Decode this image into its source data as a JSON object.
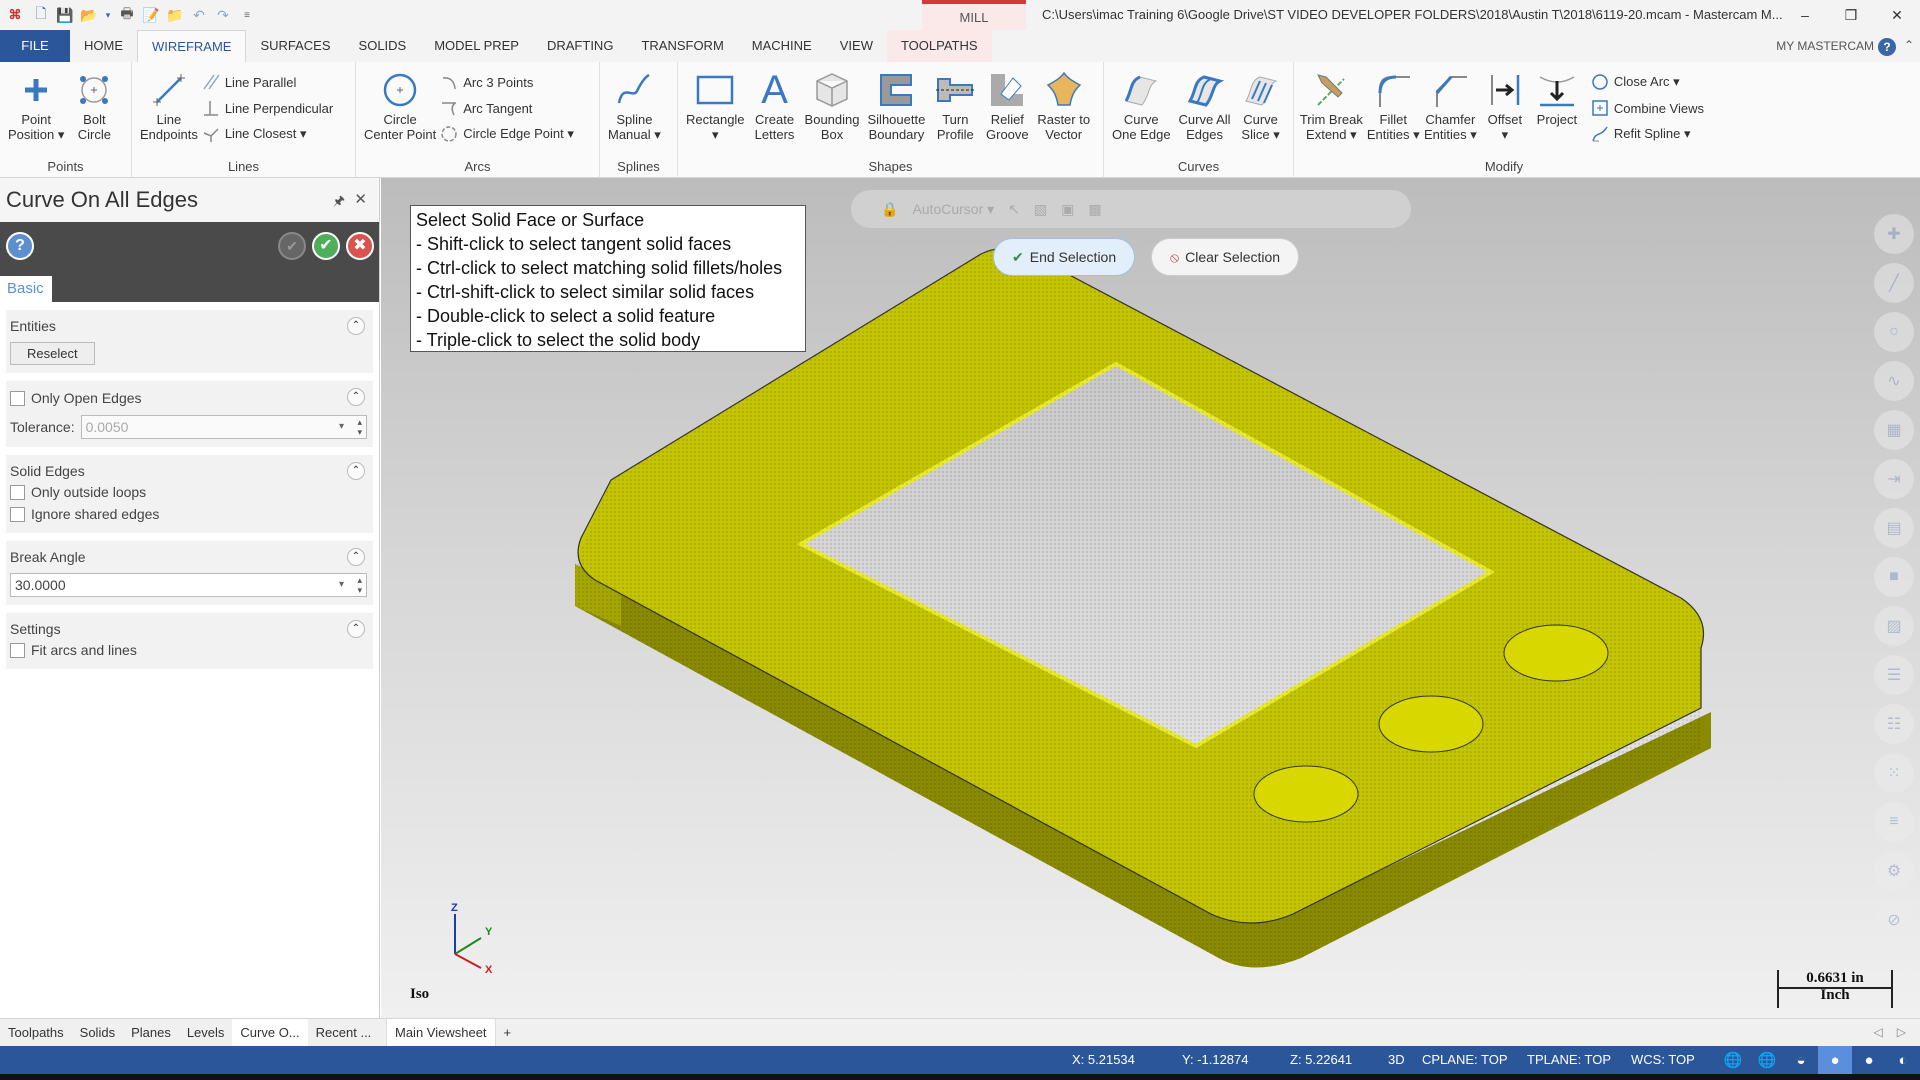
{
  "titlebar": {
    "app_logo": "mastercam-logo",
    "quick_access": [
      "new-file-icon",
      "save-icon",
      "open-icon",
      "dropdown-icon",
      "print-icon",
      "save-as-icon",
      "folder-icon",
      "undo-icon",
      "redo-icon",
      "customize-icon"
    ],
    "context_tab": "MILL",
    "title": "C:\\Users\\imac Training 6\\Google Drive\\ST VIDEO DEVELOPER FOLDERS\\2018\\Austin T\\2018\\6119-20.mcam - Mastercam M...",
    "window_buttons": {
      "minimize": "–",
      "restore": "❒",
      "close": "✕"
    }
  },
  "tabs": [
    "FILE",
    "HOME",
    "WIREFRAME",
    "SURFACES",
    "SOLIDS",
    "MODEL PREP",
    "DRAFTING",
    "TRANSFORM",
    "MACHINE",
    "VIEW",
    "TOOLPATHS"
  ],
  "active_tab": "WIREFRAME",
  "my_mastercam": "MY MASTERCAM",
  "help_label": "?",
  "ribbon": {
    "points": {
      "label": "Points",
      "buttons": [
        {
          "l1": "Point",
          "l2": "Position ▾"
        },
        {
          "l1": "Bolt",
          "l2": "Circle"
        }
      ]
    },
    "lines": {
      "label": "Lines",
      "big": {
        "l1": "Line",
        "l2": "Endpoints"
      },
      "small": [
        "Line Parallel",
        "Line Perpendicular",
        "Line Closest ▾"
      ]
    },
    "arcs": {
      "label": "Arcs",
      "big": {
        "l1": "Circle",
        "l2": "Center Point"
      },
      "small": [
        "Arc 3 Points",
        "Arc Tangent",
        "Circle Edge Point ▾"
      ]
    },
    "splines": {
      "label": "Splines",
      "big": {
        "l1": "Spline",
        "l2": "Manual ▾"
      }
    },
    "shapes": {
      "label": "Shapes",
      "buttons": [
        {
          "l1": "Rectangle",
          "l2": "▾"
        },
        {
          "l1": "Create",
          "l2": "Letters"
        },
        {
          "l1": "Bounding",
          "l2": "Box"
        },
        {
          "l1": "Silhouette",
          "l2": "Boundary"
        },
        {
          "l1": "Turn",
          "l2": "Profile"
        },
        {
          "l1": "Relief",
          "l2": "Groove"
        },
        {
          "l1": "Raster to",
          "l2": "Vector"
        }
      ]
    },
    "curves": {
      "label": "Curves",
      "buttons": [
        {
          "l1": "Curve",
          "l2": "One Edge"
        },
        {
          "l1": "Curve All",
          "l2": "Edges"
        },
        {
          "l1": "Curve",
          "l2": "Slice ▾"
        }
      ]
    },
    "modify": {
      "label": "Modify",
      "buttons": [
        {
          "l1": "Trim Break",
          "l2": "Extend ▾"
        },
        {
          "l1": "Fillet",
          "l2": "Entities ▾"
        },
        {
          "l1": "Chamfer",
          "l2": "Entities ▾"
        },
        {
          "l1": "Offset",
          "l2": "▾"
        },
        {
          "l1": "Project",
          "l2": ""
        }
      ],
      "small": [
        "Close Arc ▾",
        "Combine Views",
        "Refit Spline ▾"
      ]
    }
  },
  "panel": {
    "title": "Curve On All Edges",
    "tab": "Basic",
    "entities": {
      "header": "Entities",
      "button": "Reselect"
    },
    "open_edges": {
      "checkbox": "Only Open Edges",
      "checked": false,
      "tolerance_label": "Tolerance:",
      "tolerance_value": "0.0050"
    },
    "solid_edges": {
      "header": "Solid Edges",
      "opt1": "Only outside loops",
      "opt2": "Ignore shared edges"
    },
    "break_angle": {
      "header": "Break Angle",
      "value": "30.0000"
    },
    "settings": {
      "header": "Settings",
      "opt1": "Fit arcs and lines"
    }
  },
  "viewport": {
    "prompt": [
      "Select Solid Face or Surface",
      "- Shift-click to select tangent solid faces",
      "- Ctrl-click to select matching solid fillets/holes",
      "- Ctrl-shift-click to select similar solid faces",
      "- Double-click to select a solid feature",
      "- Triple-click to select the solid body"
    ],
    "autocursor": "AutoCursor ▾",
    "end_selection": "End Selection",
    "clear_selection": "Clear Selection",
    "view_name": "Iso",
    "gnomon": {
      "z": "Z",
      "y": "Y",
      "x": "X"
    },
    "scale": {
      "value": "0.6631 in",
      "unit": "Inch"
    },
    "model_color": "#c8c800",
    "right_tools": [
      "point-icon",
      "line-icon",
      "circle-icon",
      "spline-icon",
      "surface-icon",
      "dimension-icon",
      "solid-icon",
      "box-icon",
      "levels-icon",
      "toolpath-icon",
      "list-icon",
      "color-icon",
      "layers-icon",
      "settings-icon",
      "no-icon"
    ]
  },
  "bottom_tabs": [
    "Toolpaths",
    "Solids",
    "Planes",
    "Levels",
    "Curve O...",
    "Recent ..."
  ],
  "active_bottom_tab": "Curve O...",
  "viewsheet": {
    "tab": "Main Viewsheet",
    "add": "+"
  },
  "status": {
    "x": "X:  5.21534",
    "y": "Y:  -1.12874",
    "z": "Z:  5.22641",
    "mode": "3D",
    "cplane": "CPLANE: TOP",
    "tplane": "TPLANE: TOP",
    "wcs": "WCS: TOP"
  }
}
